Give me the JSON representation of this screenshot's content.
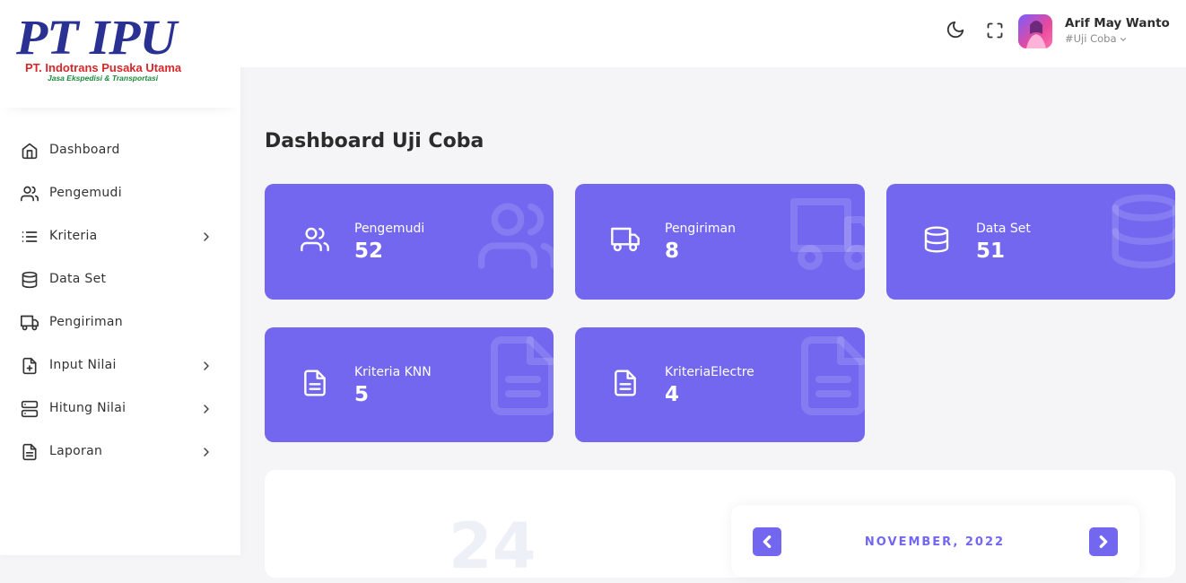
{
  "brand": {
    "logo_text": "PT IPU",
    "company": "PT. Indotrans Pusaka Utama",
    "tagline": "Jasa Ekspedisi & Transportasi"
  },
  "sidebar": {
    "items": [
      {
        "label": "Dashboard",
        "icon": "home-icon"
      },
      {
        "label": "Pengemudi",
        "icon": "users-icon"
      },
      {
        "label": "Kriteria",
        "icon": "list-icon",
        "has_submenu": true
      },
      {
        "label": "Data Set",
        "icon": "database-icon"
      },
      {
        "label": "Pengiriman",
        "icon": "truck-icon"
      },
      {
        "label": "Input Nilai",
        "icon": "file-plus-icon",
        "has_submenu": true
      },
      {
        "label": "Hitung Nilai",
        "icon": "server-icon",
        "has_submenu": true
      },
      {
        "label": "Laporan",
        "icon": "file-text-icon",
        "has_submenu": true
      }
    ]
  },
  "header": {
    "user_name": "Arif May Wanto",
    "user_role": "#Uji Coba"
  },
  "main": {
    "title": "Dashboard Uji Coba",
    "cards": [
      {
        "label": "Pengemudi",
        "value": "52",
        "icon": "users-icon"
      },
      {
        "label": "Pengiriman",
        "value": "8",
        "icon": "truck-icon"
      },
      {
        "label": "Data Set",
        "value": "51",
        "icon": "database-icon"
      },
      {
        "label": "Kriteria KNN",
        "value": "5",
        "icon": "file-text-icon"
      },
      {
        "label": "KriteriaElectre",
        "value": "4",
        "icon": "file-text-icon"
      }
    ],
    "big_number": "24",
    "calendar": {
      "month_label": "NOVEMBER, 2022"
    }
  },
  "colors": {
    "accent": "#7367f0",
    "logo_blue": "#2b3192",
    "logo_red": "#d8262a",
    "logo_green": "#1a8a3a"
  }
}
